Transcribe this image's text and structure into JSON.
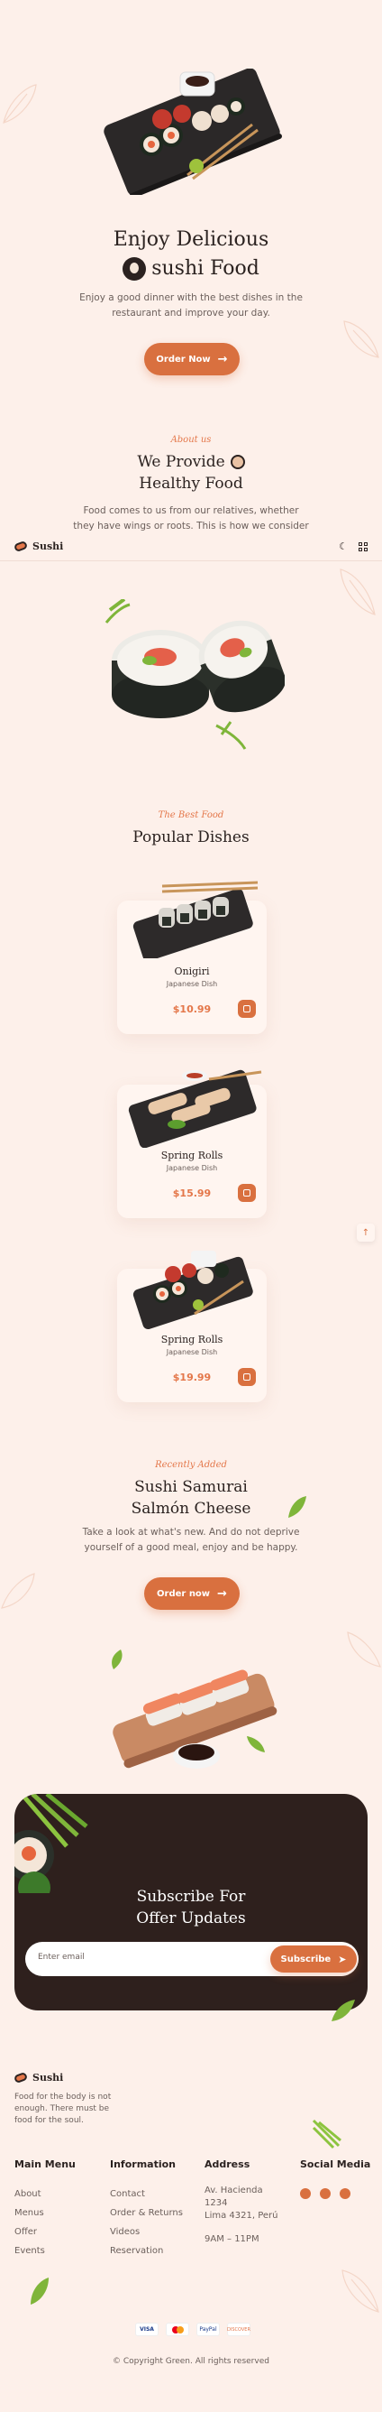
{
  "hero": {
    "title_line1": "Enjoy Delicious",
    "title_line2": "sushi Food",
    "subtitle": "Enjoy a good dinner with the best dishes in the restaurant and improve your day.",
    "cta_label": "Order Now"
  },
  "about": {
    "tag": "About us",
    "title_line1": "We Provide",
    "title_line2": "Healthy Food",
    "text": "Food comes to us from our relatives, whether they have wings or roots. This is how we consider food, it"
  },
  "header": {
    "logo_text": "Sushi"
  },
  "popular": {
    "tag": "The Best Food",
    "title": "Popular Dishes",
    "dishes": [
      {
        "name": "Onigiri",
        "type": "Japanese Dish",
        "price": "$10.99"
      },
      {
        "name": "Spring Rolls",
        "type": "Japanese Dish",
        "price": "$15.99"
      },
      {
        "name": "Spring Rolls",
        "type": "Japanese Dish",
        "price": "$19.99"
      }
    ]
  },
  "recent": {
    "tag": "Recently Added",
    "title_line1": "Sushi Samurai",
    "title_line2": "Salmón Cheese",
    "text": "Take a look at what's new. And do not deprive yourself of a good meal, enjoy and be happy.",
    "cta_label": "Order now"
  },
  "subscribe": {
    "title_line1": "Subscribe For",
    "title_line2": "Offer Updates",
    "placeholder": "Enter email",
    "button_label": "Subscribe"
  },
  "footer": {
    "logo_text": "Sushi",
    "tagline": "Food for the body is not enough. There must be food for the soul.",
    "columns": [
      {
        "title": "Main Menu",
        "items": [
          "About",
          "Menus",
          "Offer",
          "Events"
        ]
      },
      {
        "title": "Information",
        "items": [
          "Contact",
          "Order & Returns",
          "Videos",
          "Reservation"
        ]
      },
      {
        "title": "Address",
        "items": [
          "Av. Hacienda",
          "1234",
          "Lima 4321, Perú",
          "9AM – 11PM"
        ]
      },
      {
        "title": "Social Media",
        "items": []
      }
    ],
    "payments": [
      "VISA",
      "MC",
      "PayPal",
      "DISCOVER"
    ],
    "copyright": "© Copyright Green. All rights reserved"
  },
  "colors": {
    "accent": "#d9703f",
    "background": "#fdf0ea",
    "dark": "#2e201d"
  }
}
